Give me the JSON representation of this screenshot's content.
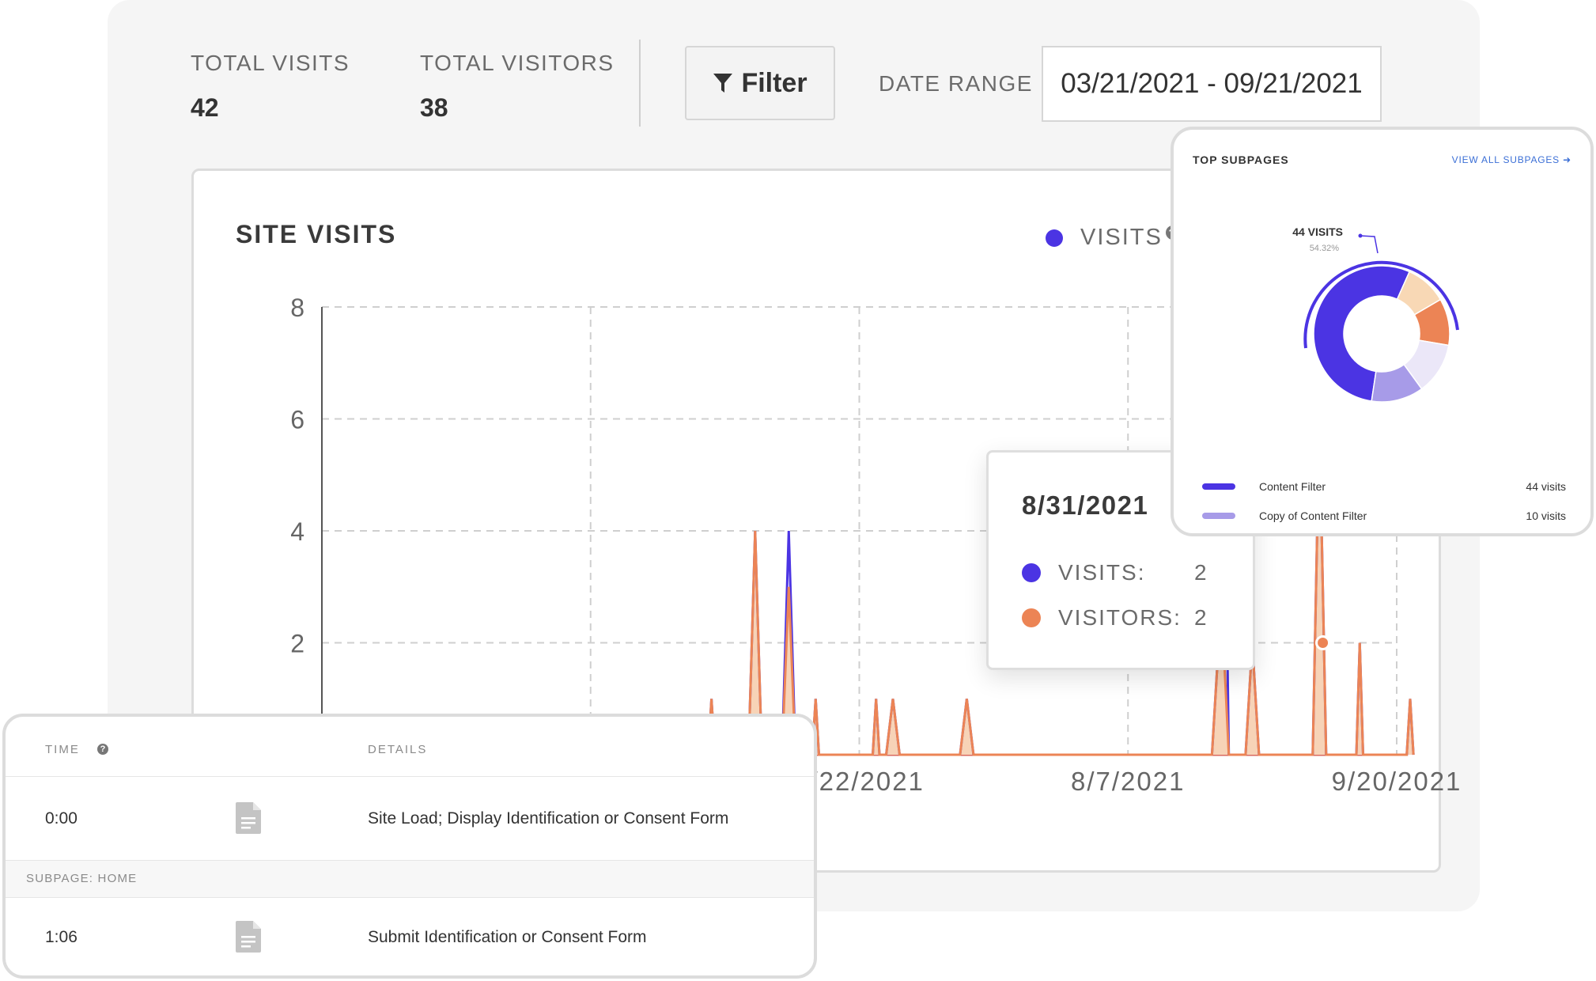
{
  "stats": {
    "total_visits_label": "TOTAL VISITS",
    "total_visits_value": "42",
    "total_visitors_label": "TOTAL VISITORS",
    "total_visitors_value": "38"
  },
  "toolbar": {
    "filter_label": "Filter",
    "filter_icon": "funnel-icon",
    "date_range_label": "DATE RANGE",
    "date_range_value": "03/21/2021 - 09/21/2021"
  },
  "site_visits": {
    "title": "SITE VISITS",
    "legend_label": "VISITS",
    "help_symbol": "?"
  },
  "colors": {
    "visits": "#4b34e3",
    "visitors": "#ec8455",
    "visitors_fill": "#f7d3b7",
    "grid": "#cfcfcf"
  },
  "chart_data": {
    "type": "area",
    "ylim": [
      0,
      8
    ],
    "yticks": [
      "2",
      "4",
      "6",
      "8"
    ],
    "xticks": [
      "7/22/2021",
      "8/7/2021",
      "9/20/2021"
    ],
    "series": [
      {
        "name": "VISITS",
        "color": "#4b34e3",
        "points": [
          [
            5.75,
            0
          ],
          [
            5.8,
            1
          ],
          [
            5.85,
            0
          ],
          [
            6.35,
            0
          ],
          [
            6.45,
            4
          ],
          [
            6.55,
            0
          ],
          [
            6.85,
            0
          ],
          [
            6.95,
            4
          ],
          [
            7.05,
            0
          ],
          [
            7.3,
            0
          ],
          [
            7.35,
            1
          ],
          [
            7.4,
            0
          ],
          [
            8.2,
            0
          ],
          [
            8.25,
            1
          ],
          [
            8.3,
            0
          ],
          [
            8.4,
            0
          ],
          [
            8.5,
            1
          ],
          [
            8.6,
            0
          ],
          [
            9.5,
            0
          ],
          [
            9.6,
            1
          ],
          [
            9.7,
            0
          ],
          [
            13.25,
            0
          ],
          [
            13.35,
            2
          ],
          [
            13.42,
            7
          ],
          [
            13.5,
            0
          ],
          [
            13.75,
            0
          ],
          [
            13.85,
            2
          ],
          [
            13.95,
            0
          ],
          [
            14.75,
            0
          ],
          [
            14.85,
            6
          ],
          [
            14.95,
            0
          ],
          [
            15.4,
            0
          ],
          [
            15.45,
            2
          ],
          [
            15.5,
            0
          ],
          [
            16.15,
            0
          ],
          [
            16.2,
            1
          ],
          [
            16.25,
            0
          ]
        ]
      },
      {
        "name": "VISITORS",
        "color": "#ec8455",
        "points": [
          [
            5.75,
            0
          ],
          [
            5.8,
            1
          ],
          [
            5.85,
            0
          ],
          [
            6.35,
            0
          ],
          [
            6.45,
            4
          ],
          [
            6.55,
            0
          ],
          [
            6.85,
            0
          ],
          [
            6.95,
            3
          ],
          [
            7.05,
            0
          ],
          [
            7.3,
            0
          ],
          [
            7.35,
            1
          ],
          [
            7.4,
            0
          ],
          [
            8.2,
            0
          ],
          [
            8.25,
            1
          ],
          [
            8.3,
            0
          ],
          [
            8.4,
            0
          ],
          [
            8.5,
            1
          ],
          [
            8.6,
            0
          ],
          [
            9.5,
            0
          ],
          [
            9.6,
            1
          ],
          [
            9.7,
            0
          ],
          [
            13.25,
            0
          ],
          [
            13.35,
            2
          ],
          [
            13.42,
            2
          ],
          [
            13.5,
            0
          ],
          [
            13.75,
            0
          ],
          [
            13.85,
            2
          ],
          [
            13.95,
            0
          ],
          [
            14.75,
            0
          ],
          [
            14.85,
            6
          ],
          [
            14.95,
            0
          ],
          [
            15.4,
            0
          ],
          [
            15.45,
            2
          ],
          [
            15.5,
            0
          ],
          [
            16.15,
            0
          ],
          [
            16.2,
            1
          ],
          [
            16.25,
            0
          ]
        ]
      }
    ]
  },
  "tooltip": {
    "date": "8/31/2021",
    "visits_label": "VISITS:",
    "visits_value": "2",
    "visitors_label": "VISITORS:",
    "visitors_value": "2"
  },
  "top_subpages": {
    "title": "TOP SUBPAGES",
    "view_all_label": "VIEW ALL SUBPAGES",
    "view_all_icon": "arrow-right-icon",
    "callout_value": "44 VISITS",
    "callout_pct": "54.32%",
    "slices": [
      {
        "value": 54.32,
        "color": "#4b34e3"
      },
      {
        "value": 9.9,
        "color": "#f8d8b5"
      },
      {
        "value": 11.1,
        "color": "#ec8455"
      },
      {
        "value": 12.3,
        "color": "#ebe7f8"
      },
      {
        "value": 12.38,
        "color": "#a79be8"
      }
    ],
    "items": [
      {
        "label": "Content Filter",
        "count": "44 visits",
        "color": "#4b34e3"
      },
      {
        "label": "Copy of Content Filter",
        "count": "10 visits",
        "color": "#a79be8"
      }
    ]
  },
  "log": {
    "time_header": "TIME",
    "details_header": "DETAILS",
    "help_symbol": "?",
    "rows": [
      {
        "time": "0:00",
        "icon": "document-icon",
        "details": "Site Load; Display Identification or Consent Form"
      },
      {
        "time": "1:06",
        "icon": "document-icon",
        "details": "Submit Identification or Consent Form"
      }
    ],
    "section_label": "SUBPAGE: HOME"
  }
}
